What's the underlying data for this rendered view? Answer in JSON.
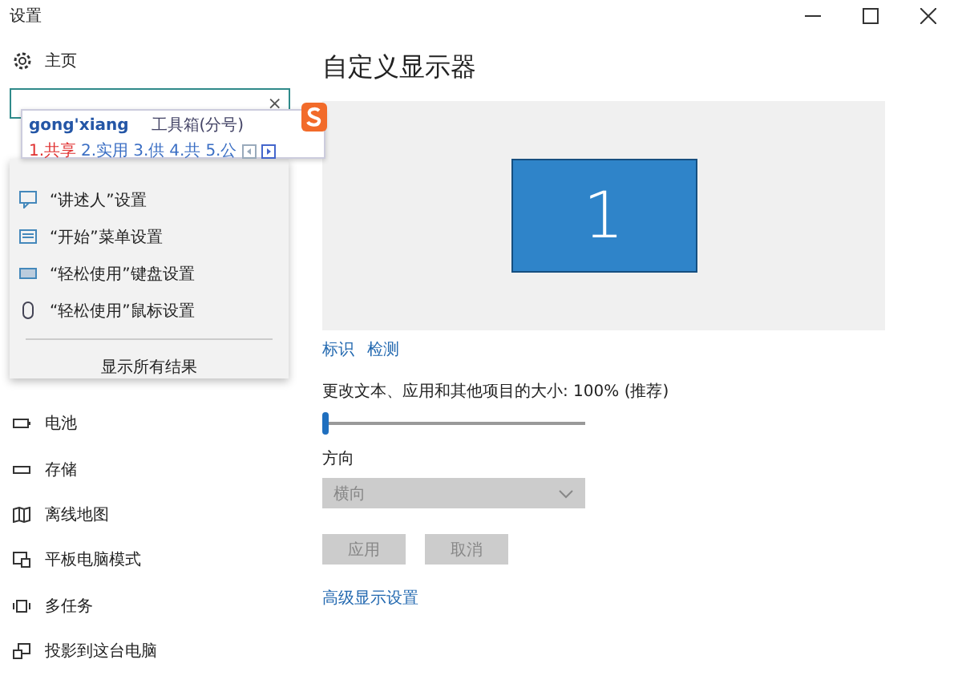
{
  "window": {
    "title": "设置"
  },
  "sidebar": {
    "home": "主页",
    "items": [
      {
        "label": "电池",
        "kind": "battery"
      },
      {
        "label": "存储",
        "kind": "storage"
      },
      {
        "label": "离线地图",
        "kind": "map"
      },
      {
        "label": "平板电脑模式",
        "kind": "tablet"
      },
      {
        "label": "多任务",
        "kind": "multitask"
      },
      {
        "label": "投影到这台电脑",
        "kind": "project"
      }
    ]
  },
  "search": {
    "clear": "×"
  },
  "ime": {
    "composition": "gong'xiang",
    "toolbox": "工具箱(分号)",
    "candidates": [
      {
        "label": "1.共享",
        "selected": true
      },
      {
        "label": "2.实用",
        "selected": false
      },
      {
        "label": "3.供",
        "selected": false
      },
      {
        "label": "4.共",
        "selected": false
      },
      {
        "label": "5.公",
        "selected": false
      }
    ]
  },
  "suggestions": {
    "items": [
      {
        "label": "“讲述人”设置",
        "kind": "narrator"
      },
      {
        "label": "“开始”菜单设置",
        "kind": "start"
      },
      {
        "label": "“轻松使用”键盘设置",
        "kind": "keyboard"
      },
      {
        "label": "“轻松使用”鼠标设置",
        "kind": "mouse"
      }
    ],
    "show_all": "显示所有结果"
  },
  "main": {
    "title": "自定义显示器",
    "monitor": "1",
    "links": [
      "标识",
      "检测"
    ],
    "scale": {
      "label": "更改文本、应用和其他项目的大小: 100% (推荐)",
      "level": 0
    },
    "orientation": {
      "label": "方向",
      "value": "横向",
      "disabled": true
    },
    "buttons": [
      {
        "label": "应用",
        "disabled": true
      },
      {
        "label": "取消",
        "disabled": true
      }
    ],
    "advanced": "高级显示设置"
  }
}
